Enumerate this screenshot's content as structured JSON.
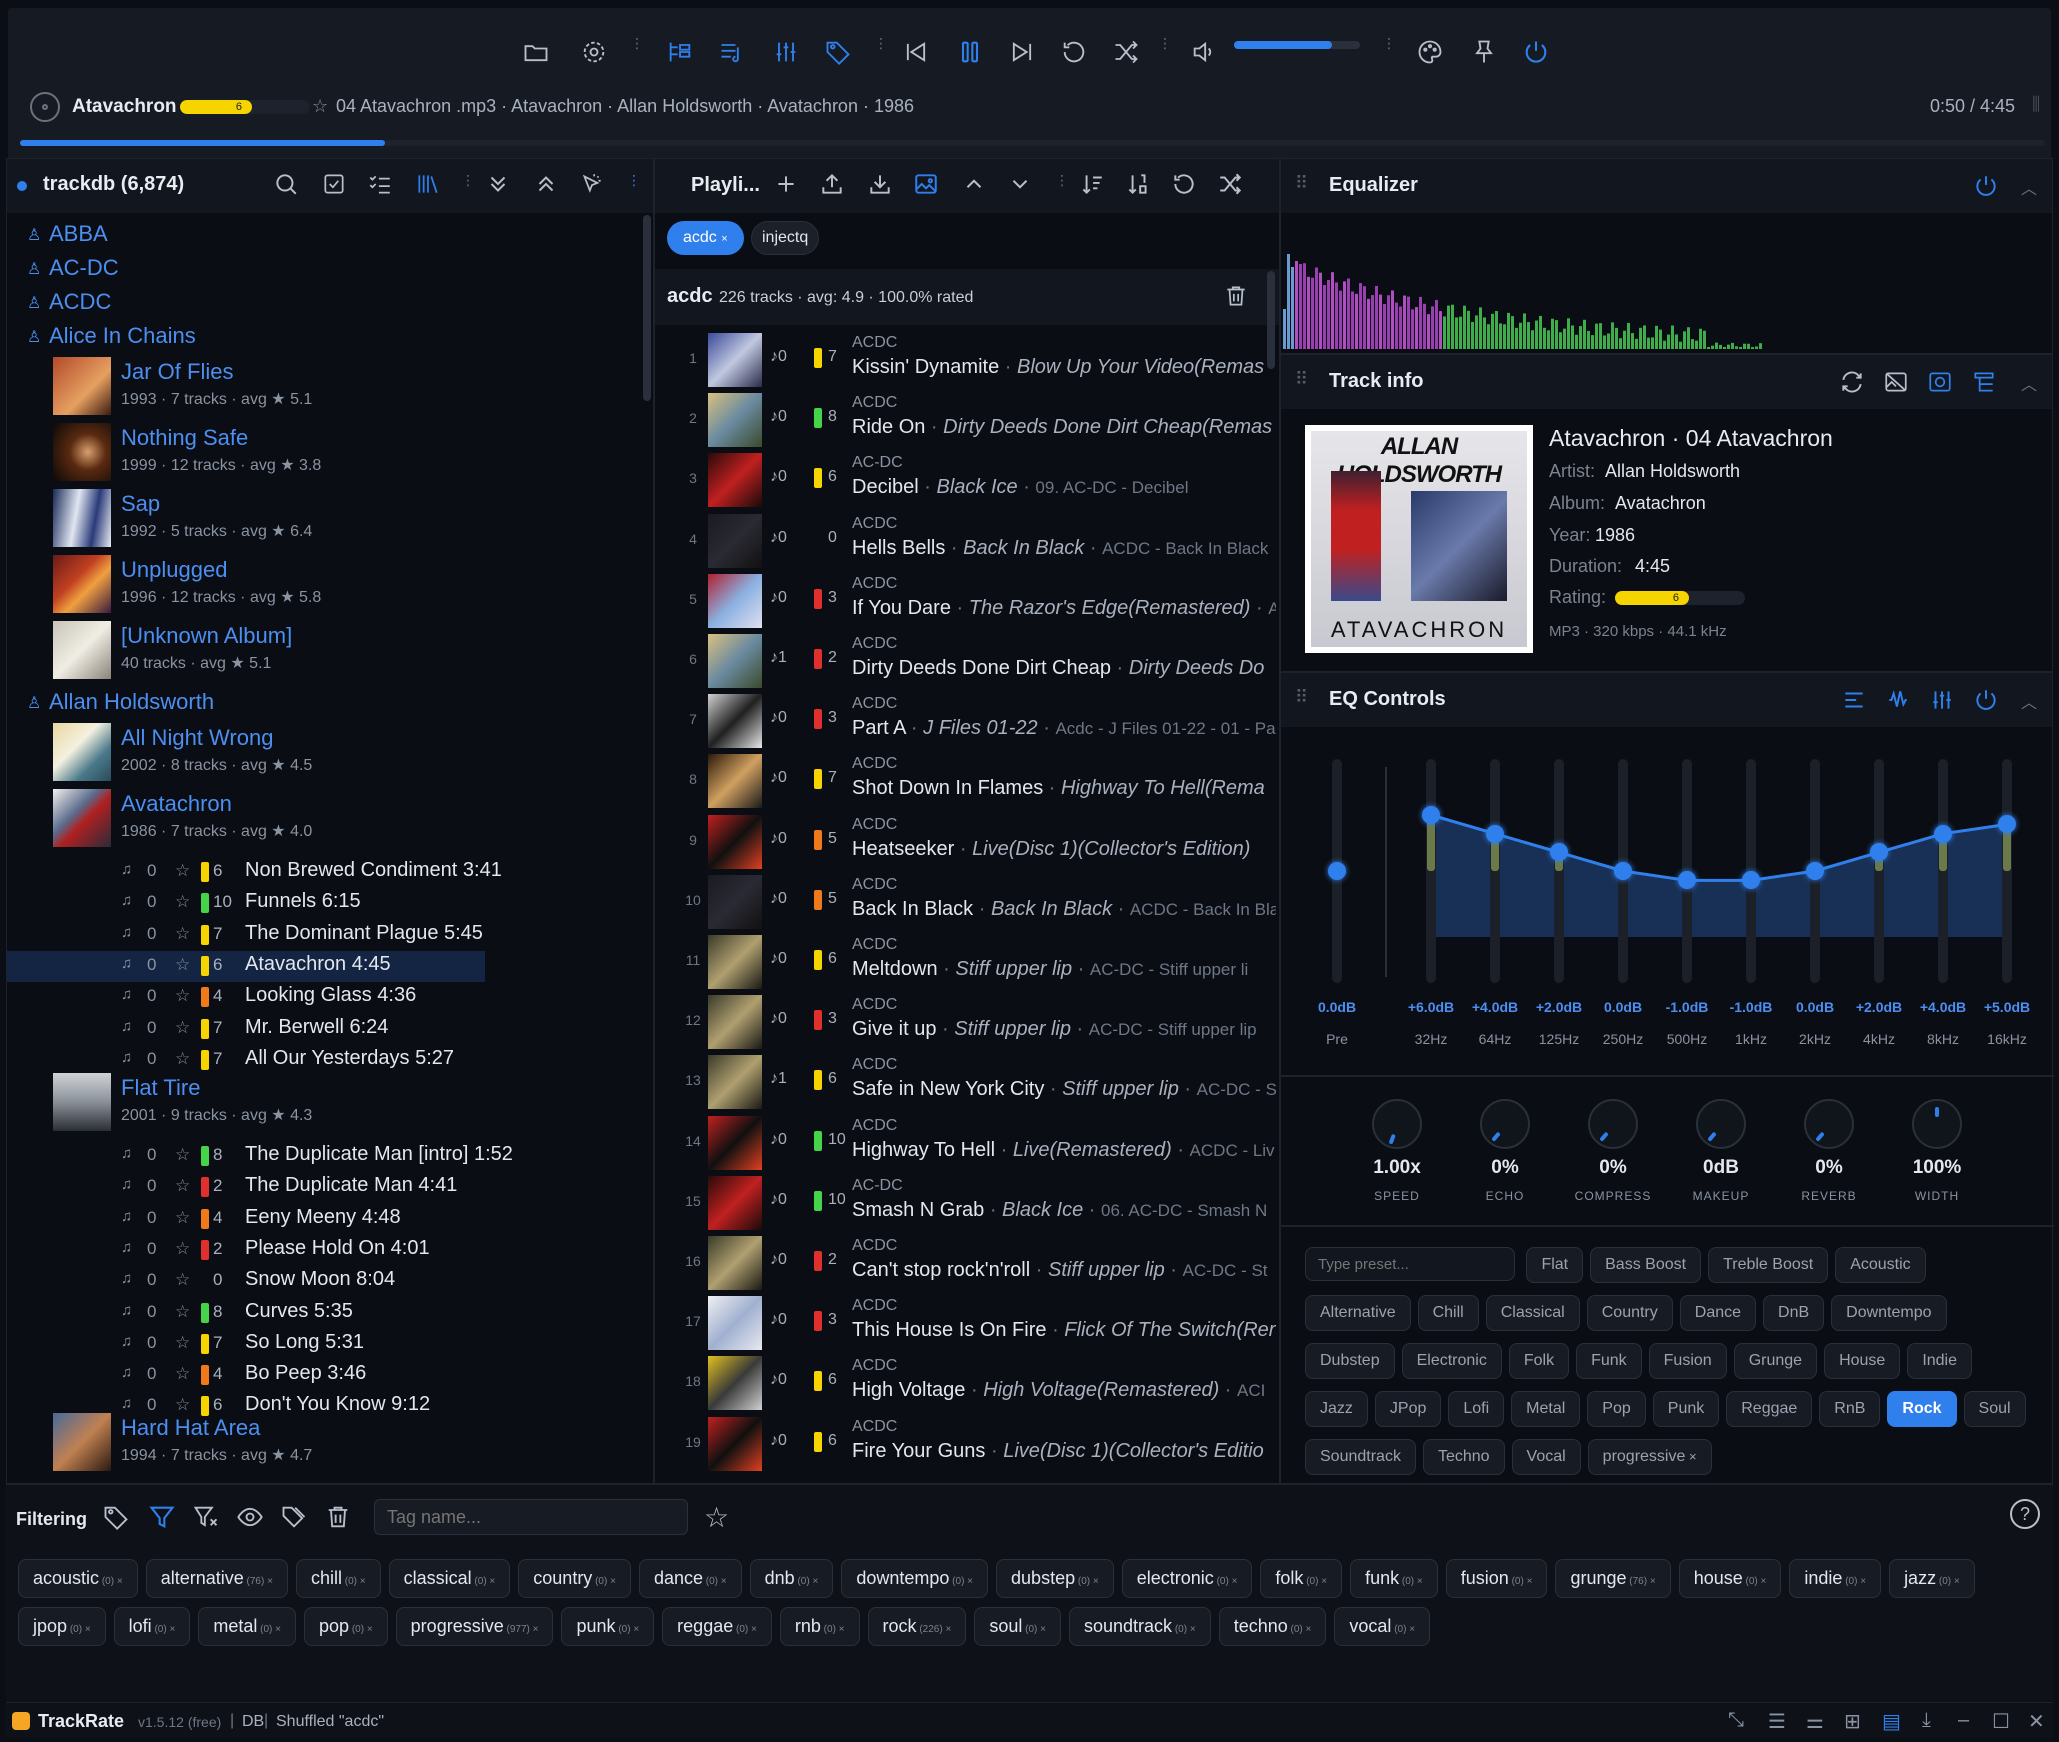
{
  "colors": {
    "accent": "#2f80ed",
    "rating_yellow": "#f5d400",
    "rating_orange": "#f07a1a",
    "rating_red": "#e0302d",
    "rating_green": "#45d34a",
    "rating_lime": "#b8e62b"
  },
  "now_playing": {
    "title": "Atavachron",
    "rating": "6",
    "info": "04 Atavachron .mp3 · Atavachron · Allan Holdsworth · Avatachron · 1986",
    "time": "0:50 / 4:45",
    "progress": 0.18
  },
  "volume": 0.78,
  "library": {
    "title": "trackdb (6,874)",
    "artists": [
      "ABBA",
      "AC-DC",
      "ACDC",
      "Alice In Chains",
      "Allan Holdsworth"
    ],
    "albums_aic": [
      {
        "title": "Jar Of Flies",
        "meta": "1993 · 7 tracks · avg ★ 5.1"
      },
      {
        "title": "Nothing Safe",
        "meta": "1999 · 12 tracks · avg ★ 3.8"
      },
      {
        "title": "Sap",
        "meta": "1992 · 5 tracks · avg ★ 6.4"
      },
      {
        "title": "Unplugged",
        "meta": "1996 · 12 tracks · avg ★ 5.8"
      },
      {
        "title": "[Unknown Album]",
        "meta": "40 tracks · avg ★ 5.1"
      }
    ],
    "albums_ah": [
      {
        "title": "All Night Wrong",
        "meta": "2002 · 8 tracks · avg ★ 4.5"
      },
      {
        "title": "Avatachron",
        "meta": "1986 · 7 tracks · avg ★ 4.0"
      },
      {
        "title": "Flat Tire",
        "meta": "2001 · 9 tracks · avg ★ 4.3"
      },
      {
        "title": "Hard Hat Area",
        "meta": "1994 · 7 tracks · avg ★ 4.7"
      }
    ],
    "tracks_avatachron": [
      {
        "plays": "0",
        "rating": "6",
        "title": "Non Brewed Condiment 3:41"
      },
      {
        "plays": "0",
        "rating": "10",
        "title": "Funnels 6:15"
      },
      {
        "plays": "0",
        "rating": "7",
        "title": "The Dominant Plague 5:45"
      },
      {
        "plays": "0",
        "rating": "6",
        "title": "Atavachron 4:45"
      },
      {
        "plays": "0",
        "rating": "4",
        "title": "Looking Glass 4:36"
      },
      {
        "plays": "0",
        "rating": "7",
        "title": "Mr. Berwell 6:24"
      },
      {
        "plays": "0",
        "rating": "7",
        "title": "All Our Yesterdays 5:27"
      }
    ],
    "tracks_flat": [
      {
        "plays": "0",
        "rating": "8",
        "title": "The Duplicate Man [intro] 1:52"
      },
      {
        "plays": "0",
        "rating": "2",
        "title": "The Duplicate Man 4:41"
      },
      {
        "plays": "0",
        "rating": "4",
        "title": "Eeny Meeny 4:48"
      },
      {
        "plays": "0",
        "rating": "2",
        "title": "Please Hold On 4:01"
      },
      {
        "plays": "0",
        "rating": "0",
        "title": "Snow Moon 8:04"
      },
      {
        "plays": "0",
        "rating": "8",
        "title": "Curves 5:35"
      },
      {
        "plays": "0",
        "rating": "7",
        "title": "So Long 5:31"
      },
      {
        "plays": "0",
        "rating": "4",
        "title": "Bo Peep 3:46"
      },
      {
        "plays": "0",
        "rating": "6",
        "title": "Don't You Know 9:12"
      }
    ]
  },
  "playlist": {
    "title": "Playli...",
    "tabs": [
      "acdc",
      "injectq"
    ],
    "summary_name": "acdc",
    "summary_rest": "226 tracks · avg: 4.9 · 100.0% rated",
    "rows": [
      {
        "n": "1",
        "plays": "♪0",
        "rating": "7",
        "artist": "ACDC",
        "title": "Kissin' Dynamite",
        "album": "Blow Up Your Video(Remas",
        "sub": ""
      },
      {
        "n": "2",
        "plays": "♪0",
        "rating": "8",
        "artist": "ACDC",
        "title": "Ride On",
        "album": "Dirty Deeds Done Dirt Cheap(Remas",
        "sub": ""
      },
      {
        "n": "3",
        "plays": "♪0",
        "rating": "6",
        "artist": "AC-DC",
        "title": "Decibel",
        "album": "Black Ice",
        "sub": "09. AC-DC - Decibel"
      },
      {
        "n": "4",
        "plays": "♪0",
        "rating": "0",
        "artist": "ACDC",
        "title": "Hells Bells",
        "album": "Back In Black",
        "sub": "ACDC - Back In Black"
      },
      {
        "n": "5",
        "plays": "♪0",
        "rating": "3",
        "artist": "ACDC",
        "title": "If You Dare",
        "album": "The Razor's Edge(Remastered)",
        "sub": "A"
      },
      {
        "n": "6",
        "plays": "♪1",
        "rating": "2",
        "artist": "ACDC",
        "title": "Dirty Deeds Done Dirt Cheap",
        "album": "Dirty Deeds Do",
        "sub": ""
      },
      {
        "n": "7",
        "plays": "♪0",
        "rating": "3",
        "artist": "ACDC",
        "title": "Part A",
        "album": "J Files 01-22",
        "sub": "Acdc - J Files 01-22 - 01 - Par"
      },
      {
        "n": "8",
        "plays": "♪0",
        "rating": "7",
        "artist": "ACDC",
        "title": "Shot Down In Flames",
        "album": "Highway To Hell(Rema",
        "sub": ""
      },
      {
        "n": "9",
        "plays": "♪0",
        "rating": "5",
        "artist": "ACDC",
        "title": "Heatseeker",
        "album": "Live(Disc 1)(Collector's Edition)",
        "sub": ""
      },
      {
        "n": "10",
        "plays": "♪0",
        "rating": "5",
        "artist": "ACDC",
        "title": "Back In Black",
        "album": "Back In Black",
        "sub": "ACDC - Back In Bla"
      },
      {
        "n": "11",
        "plays": "♪0",
        "rating": "6",
        "artist": "ACDC",
        "title": "Meltdown",
        "album": "Stiff upper lip",
        "sub": "AC-DC - Stiff upper li"
      },
      {
        "n": "12",
        "plays": "♪0",
        "rating": "3",
        "artist": "ACDC",
        "title": "Give it up",
        "album": "Stiff upper lip",
        "sub": "AC-DC - Stiff upper lip"
      },
      {
        "n": "13",
        "plays": "♪1",
        "rating": "6",
        "artist": "ACDC",
        "title": "Safe in New York City",
        "album": "Stiff upper lip",
        "sub": "AC-DC - S"
      },
      {
        "n": "14",
        "plays": "♪0",
        "rating": "10",
        "artist": "ACDC",
        "title": "Highway To Hell",
        "album": "Live(Remastered)",
        "sub": "ACDC - Liv"
      },
      {
        "n": "15",
        "plays": "♪0",
        "rating": "10",
        "artist": "AC-DC",
        "title": "Smash N Grab",
        "album": "Black Ice",
        "sub": "06. AC-DC - Smash N"
      },
      {
        "n": "16",
        "plays": "♪0",
        "rating": "2",
        "artist": "ACDC",
        "title": "Can't stop rock'n'roll",
        "album": "Stiff upper lip",
        "sub": "AC-DC - St"
      },
      {
        "n": "17",
        "plays": "♪0",
        "rating": "3",
        "artist": "ACDC",
        "title": "This House Is On Fire",
        "album": "Flick Of The Switch(Rer",
        "sub": ""
      },
      {
        "n": "18",
        "plays": "♪0",
        "rating": "6",
        "artist": "ACDC",
        "title": "High Voltage",
        "album": "High Voltage(Remastered)",
        "sub": "ACI"
      },
      {
        "n": "19",
        "plays": "♪0",
        "rating": "6",
        "artist": "ACDC",
        "title": "Fire Your Guns",
        "album": "Live(Disc 1)(Collector's Editio",
        "sub": ""
      }
    ]
  },
  "equalizer": {
    "title": "Equalizer"
  },
  "track_info": {
    "title": "Track info",
    "heading": "Atavachron · 04 Atavachron",
    "artist_label": "Artist:",
    "artist": "Allan Holdsworth",
    "album_label": "Album:",
    "album": "Avatachron",
    "year_label": "Year:",
    "year": "1986",
    "duration_label": "Duration:",
    "duration": "4:45",
    "rating_label": "Rating:",
    "rating": "6",
    "format": "MP3 · 320 kbps · 44.1 kHz",
    "cover_text_top": "ALLAN HOLDSWORTH",
    "cover_text_bottom": "ATAVACHRON"
  },
  "eq_controls": {
    "title": "EQ Controls",
    "bands": [
      {
        "val": "0.0dB",
        "lab": "Pre",
        "db": 0
      },
      {
        "val": "+6.0dB",
        "lab": "32Hz",
        "db": 6
      },
      {
        "val": "+4.0dB",
        "lab": "64Hz",
        "db": 4
      },
      {
        "val": "+2.0dB",
        "lab": "125Hz",
        "db": 2
      },
      {
        "val": "0.0dB",
        "lab": "250Hz",
        "db": 0
      },
      {
        "val": "-1.0dB",
        "lab": "500Hz",
        "db": -1
      },
      {
        "val": "-1.0dB",
        "lab": "1kHz",
        "db": -1
      },
      {
        "val": "0.0dB",
        "lab": "2kHz",
        "db": 0
      },
      {
        "val": "+2.0dB",
        "lab": "4kHz",
        "db": 2
      },
      {
        "val": "+4.0dB",
        "lab": "8kHz",
        "db": 4
      },
      {
        "val": "+5.0dB",
        "lab": "16kHz",
        "db": 5
      }
    ],
    "knobs": [
      {
        "val": "1.00x",
        "lab": "SPEED"
      },
      {
        "val": "0%",
        "lab": "ECHO"
      },
      {
        "val": "0%",
        "lab": "COMPRESS"
      },
      {
        "val": "0dB",
        "lab": "MAKEUP"
      },
      {
        "val": "0%",
        "lab": "REVERB"
      },
      {
        "val": "100%",
        "lab": "WIDTH"
      }
    ],
    "preset_placeholder": "Type preset...",
    "presets": [
      "Flat",
      "Bass Boost",
      "Treble Boost",
      "Acoustic",
      "Alternative",
      "Chill",
      "Classical",
      "Country",
      "Dance",
      "DnB",
      "Downtempo",
      "Dubstep",
      "Electronic",
      "Folk",
      "Funk",
      "Fusion",
      "Grunge",
      "House",
      "Indie",
      "Jazz",
      "JPop",
      "Lofi",
      "Metal",
      "Pop",
      "Punk",
      "Reggae",
      "RnB",
      "Rock",
      "Soul",
      "Soundtrack",
      "Techno",
      "Vocal"
    ],
    "active_preset": "Rock",
    "custom_preset": "progressive"
  },
  "filtering": {
    "label": "Filtering",
    "tag_placeholder": "Tag name...",
    "tags": [
      {
        "name": "acoustic",
        "count": "(0)"
      },
      {
        "name": "alternative",
        "count": "(76)"
      },
      {
        "name": "chill",
        "count": "(0)"
      },
      {
        "name": "classical",
        "count": "(0)"
      },
      {
        "name": "country",
        "count": "(0)"
      },
      {
        "name": "dance",
        "count": "(0)"
      },
      {
        "name": "dnb",
        "count": "(0)"
      },
      {
        "name": "downtempo",
        "count": "(0)"
      },
      {
        "name": "dubstep",
        "count": "(0)"
      },
      {
        "name": "electronic",
        "count": "(0)"
      },
      {
        "name": "folk",
        "count": "(0)"
      },
      {
        "name": "funk",
        "count": "(0)"
      },
      {
        "name": "fusion",
        "count": "(0)"
      },
      {
        "name": "grunge",
        "count": "(76)"
      },
      {
        "name": "house",
        "count": "(0)"
      },
      {
        "name": "indie",
        "count": "(0)"
      },
      {
        "name": "jazz",
        "count": "(0)"
      },
      {
        "name": "jpop",
        "count": "(0)"
      },
      {
        "name": "lofi",
        "count": "(0)"
      },
      {
        "name": "metal",
        "count": "(0)"
      },
      {
        "name": "pop",
        "count": "(0)"
      },
      {
        "name": "progressive",
        "count": "(977)"
      },
      {
        "name": "punk",
        "count": "(0)"
      },
      {
        "name": "reggae",
        "count": "(0)"
      },
      {
        "name": "rnb",
        "count": "(0)"
      },
      {
        "name": "rock",
        "count": "(226)"
      },
      {
        "name": "soul",
        "count": "(0)"
      },
      {
        "name": "soundtrack",
        "count": "(0)"
      },
      {
        "name": "techno",
        "count": "(0)"
      },
      {
        "name": "vocal",
        "count": "(0)"
      }
    ]
  },
  "status": {
    "app": "TrackRate",
    "version": "v1.5.12 (free)",
    "db": "DB",
    "message": "Shuffled \"acdc\""
  }
}
